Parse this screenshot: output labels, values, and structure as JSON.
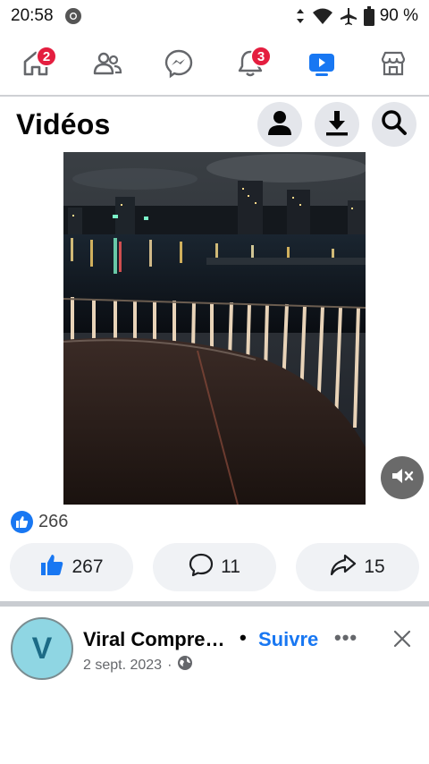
{
  "status_bar": {
    "time": "20:58",
    "battery": "90 %"
  },
  "nav": {
    "home_badge": "2",
    "notifications_badge": "3"
  },
  "header": {
    "title": "Vidéos"
  },
  "reactions": {
    "count": "266"
  },
  "actions": {
    "likes": "267",
    "comments": "11",
    "shares": "15"
  },
  "post": {
    "avatar_letter": "V",
    "name": "Viral Compre…",
    "separator": "•",
    "follow_label": "Suivre",
    "more_label": "•••",
    "date": "2 sept. 2023",
    "date_separator": "·"
  },
  "colors": {
    "accent": "#1877f2",
    "badge": "#e41e3f",
    "pill_bg": "#f0f2f5"
  },
  "icons": [
    "chrome-icon",
    "vibrate-icon",
    "wifi-icon",
    "airplane-icon",
    "battery-icon",
    "home-icon",
    "friends-icon",
    "messenger-icon",
    "bell-icon",
    "video-icon",
    "marketplace-icon",
    "profile-icon",
    "download-icon",
    "search-icon",
    "mute-icon",
    "like-icon",
    "comment-icon",
    "share-icon",
    "globe-icon",
    "close-icon"
  ]
}
